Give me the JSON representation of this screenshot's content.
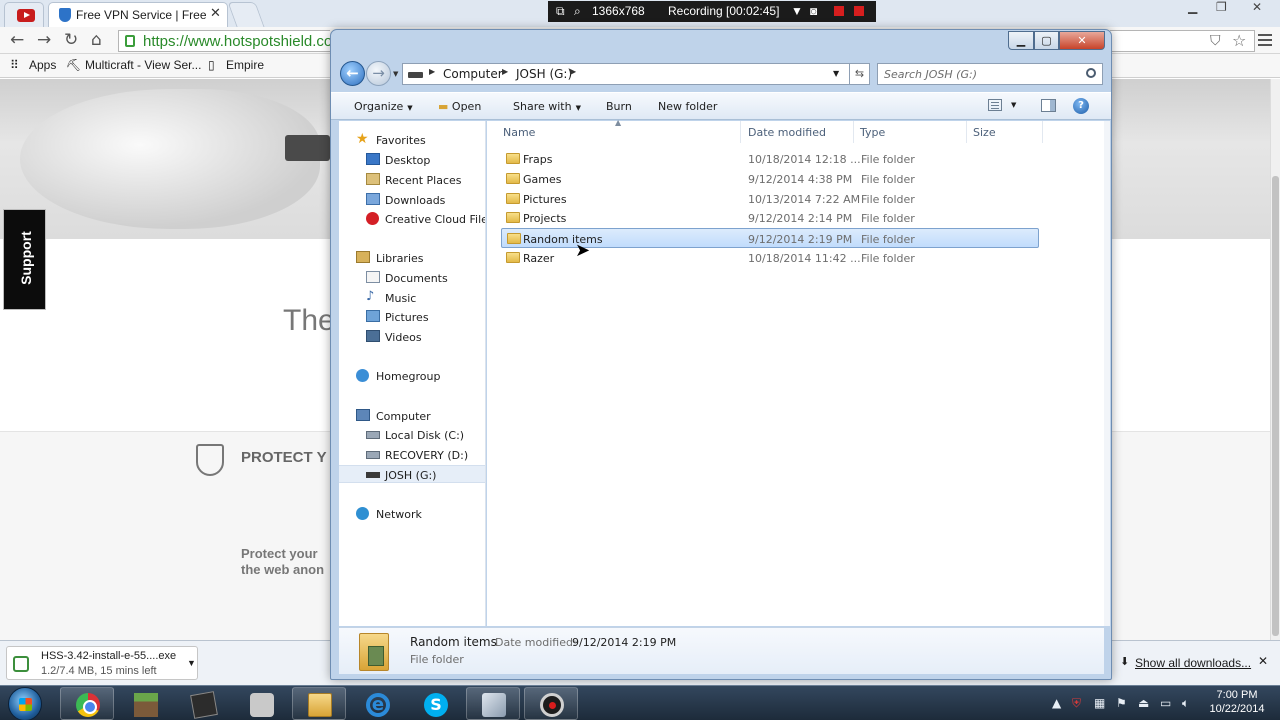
{
  "browser": {
    "tabs": [
      {
        "title": "Free VPN Service | Free VP",
        "close": "✕"
      }
    ],
    "url": "https://www.hotspotshield.co",
    "nav_glyphs": {
      "back": "←",
      "forward": "→",
      "reload": "↻",
      "home": "⌂"
    },
    "bookmarks": [
      "Apps",
      "Multicraft - View Ser...",
      "Empire"
    ],
    "page": {
      "support_label": "Support",
      "partial_heading": "The",
      "protect_title": "PROTECT Y",
      "protect_line1": "Protect your",
      "protect_line2": "the web anon"
    },
    "download": {
      "name": "HSS-3.42-install-e-55....exe",
      "status": "1.2/7.4 MB, 15 mins left",
      "show_all": "Show all downloads..."
    }
  },
  "recorder": {
    "resolution": "1366x768",
    "status": "Recording [00:02:45]"
  },
  "explorer": {
    "breadcrumb": [
      "Computer",
      "JOSH (G:)"
    ],
    "search_placeholder": "Search JOSH (G:)",
    "commands": {
      "organize": "Organize",
      "open": "Open",
      "share_with": "Share with",
      "burn": "Burn",
      "new_folder": "New folder"
    },
    "nav": {
      "favorites": "Favorites",
      "desktop": "Desktop",
      "recent_places": "Recent Places",
      "downloads": "Downloads",
      "creative_cloud": "Creative Cloud Files",
      "libraries": "Libraries",
      "documents": "Documents",
      "music": "Music",
      "pictures": "Pictures",
      "videos": "Videos",
      "homegroup": "Homegroup",
      "computer": "Computer",
      "local_disk": "Local Disk (C:)",
      "recovery": "RECOVERY (D:)",
      "josh": "JOSH (G:)",
      "network": "Network"
    },
    "columns": {
      "name": "Name",
      "date": "Date modified",
      "type": "Type",
      "size": "Size"
    },
    "files": [
      {
        "name": "Fraps",
        "date": "10/18/2014 12:18 ...",
        "type": "File folder"
      },
      {
        "name": "Games",
        "date": "9/12/2014 4:38 PM",
        "type": "File folder"
      },
      {
        "name": "Pictures",
        "date": "10/13/2014 7:22 AM",
        "type": "File folder"
      },
      {
        "name": "Projects",
        "date": "9/12/2014 2:14 PM",
        "type": "File folder"
      },
      {
        "name": "Random items",
        "date": "9/12/2014 2:19 PM",
        "type": "File folder"
      },
      {
        "name": "Razer",
        "date": "10/18/2014 11:42 ...",
        "type": "File folder"
      }
    ],
    "selected_index": 4,
    "details": {
      "name": "Random items",
      "modified_label": "Date modified:",
      "modified_value": "9/12/2014 2:19 PM",
      "type": "File folder"
    }
  },
  "taskbar": {
    "time": "7:00 PM",
    "date": "10/22/2014"
  },
  "colors": {
    "explorer_frame": "#bfd3ea",
    "selection": "#c1dcfc",
    "taskbar": "#1d2b3a",
    "url_green": "#2a8a2a"
  }
}
